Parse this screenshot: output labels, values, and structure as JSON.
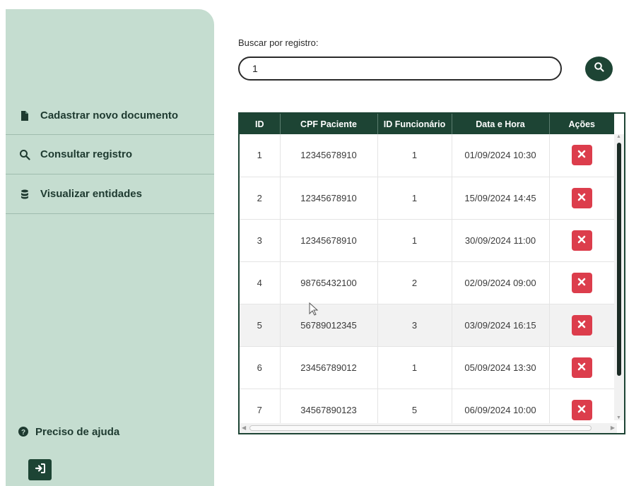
{
  "sidebar": {
    "items": [
      {
        "label": "Cadastrar novo documento",
        "icon": "file-icon"
      },
      {
        "label": "Consultar registro",
        "icon": "search-icon"
      },
      {
        "label": "Visualizar entidades",
        "icon": "database-icon"
      }
    ],
    "help_label": "Preciso de ajuda",
    "logout_icon": "logout-icon"
  },
  "search": {
    "label": "Buscar por registro:",
    "value": "1",
    "button_icon": "search-icon"
  },
  "table": {
    "headers": [
      "ID",
      "CPF Paciente",
      "ID Funcionário",
      "Data e Hora",
      "Ações"
    ],
    "rows": [
      [
        "1",
        "12345678910",
        "1",
        "01/09/2024 10:30"
      ],
      [
        "2",
        "12345678910",
        "1",
        "15/09/2024 14:45"
      ],
      [
        "3",
        "12345678910",
        "1",
        "30/09/2024 11:00"
      ],
      [
        "4",
        "98765432100",
        "2",
        "02/09/2024 09:00"
      ],
      [
        "5",
        "56789012345",
        "3",
        "03/09/2024 16:15"
      ],
      [
        "6",
        "23456789012",
        "1",
        "05/09/2024 13:30"
      ],
      [
        "7",
        "34567890123",
        "5",
        "06/09/2024 10:00"
      ]
    ],
    "action_icon": "close-icon"
  },
  "colors": {
    "sidebar_bg": "#c5ddd0",
    "primary_dark_green": "#1d4434",
    "delete_red": "#dc3d4c"
  }
}
